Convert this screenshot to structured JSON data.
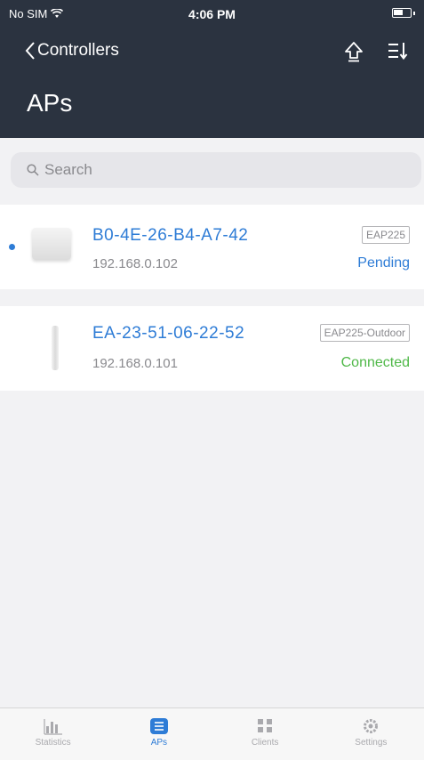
{
  "status_bar": {
    "carrier": "No SIM",
    "time": "4:06 PM"
  },
  "nav": {
    "back_label": "Controllers",
    "title": "APs"
  },
  "search": {
    "placeholder": "Search"
  },
  "devices": [
    {
      "mac": "B0-4E-26-B4-A7-42",
      "ip": "192.168.0.102",
      "model": "EAP225",
      "status": "Pending",
      "status_color": "#2e7cd6",
      "unread": true
    },
    {
      "mac": "EA-23-51-06-22-52",
      "ip": "192.168.0.101",
      "model": "EAP225-Outdoor",
      "status": "Connected",
      "status_color": "#4fb848",
      "unread": false
    }
  ],
  "tabs": [
    {
      "label": "Statistics",
      "icon": "bar-chart-icon",
      "active": false
    },
    {
      "label": "APs",
      "icon": "list-icon",
      "active": true
    },
    {
      "label": "Clients",
      "icon": "grid-icon",
      "active": false
    },
    {
      "label": "Settings",
      "icon": "gear-icon",
      "active": false
    }
  ],
  "colors": {
    "header_bg": "#2b3340",
    "accent": "#2e7cd6",
    "connected": "#4fb848"
  }
}
